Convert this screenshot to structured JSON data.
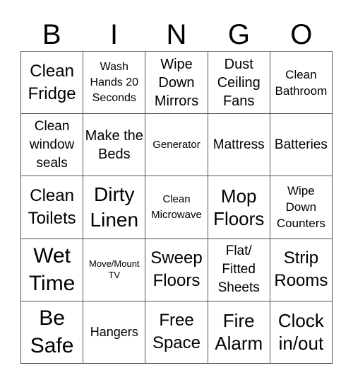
{
  "title_letters": [
    "B",
    "I",
    "N",
    "G",
    "O"
  ],
  "cells": [
    [
      "Clean Fridge",
      "Wash Hands 20 Seconds",
      "Wipe Down Mirrors",
      "Dust Ceiling Fans",
      "Clean Bathroom"
    ],
    [
      "Clean window seals",
      "Make the Beds",
      "Generator",
      "Mattress",
      "Batteries"
    ],
    [
      "Clean Toilets",
      "Dirty Linen",
      "Clean Microwave",
      "Mop Floors",
      "Wipe Down Counters"
    ],
    [
      "Wet Time",
      "Move/Mount TV",
      "Sweep Floors",
      "Flat/ Fitted Sheets",
      "Strip Rooms"
    ],
    [
      "Be Safe",
      "Hangers",
      "Free Space",
      "Fire Alarm",
      "Clock in/out"
    ]
  ]
}
